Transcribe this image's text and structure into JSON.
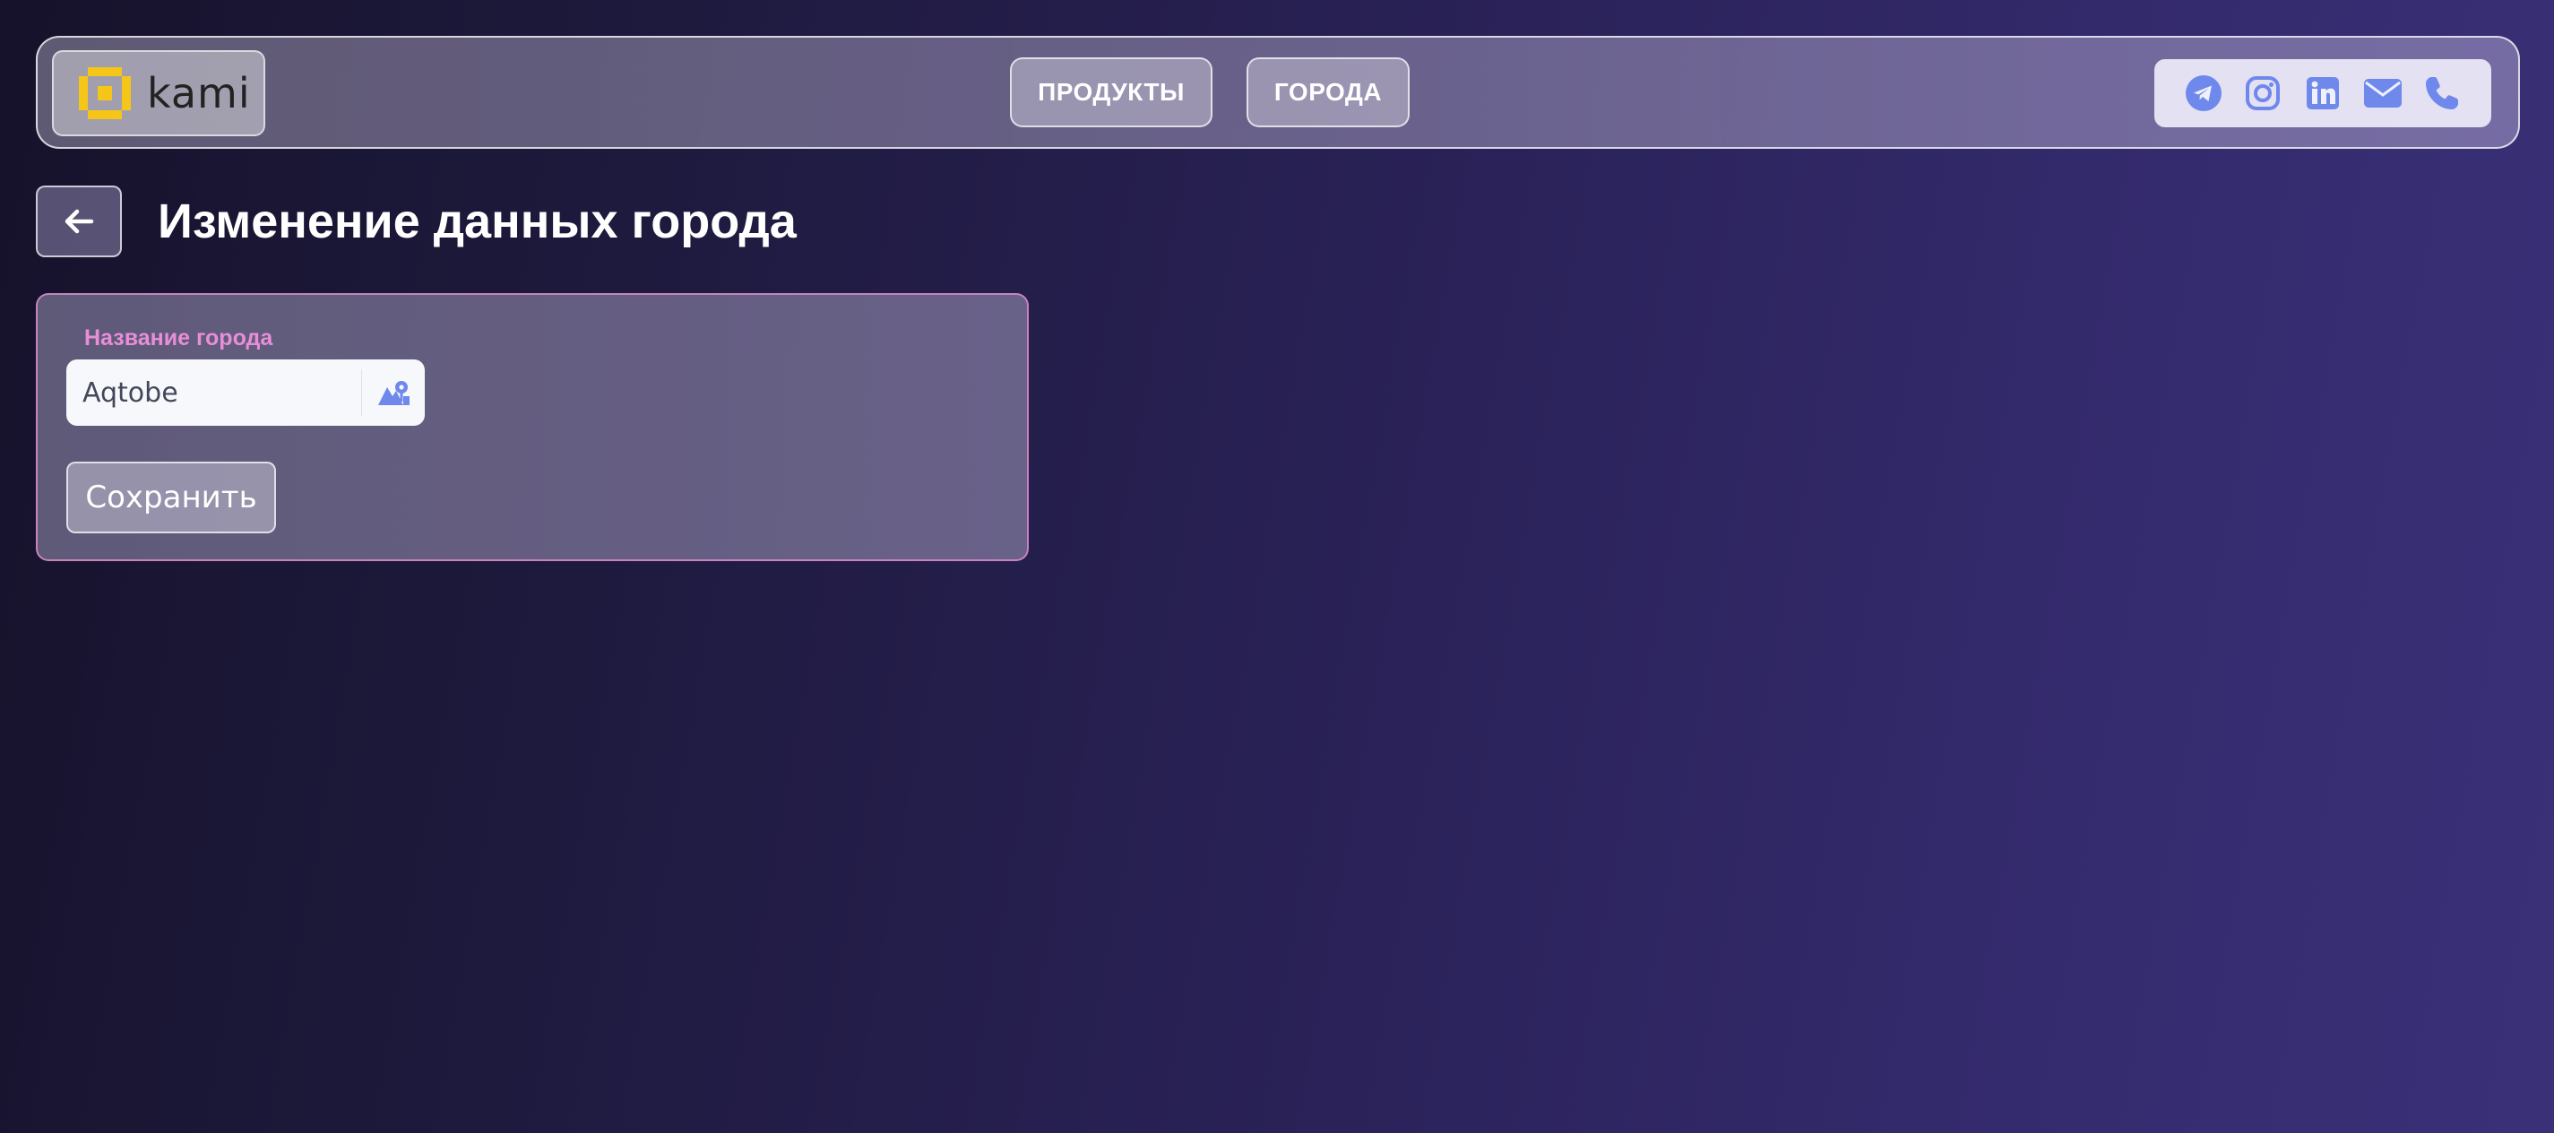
{
  "header": {
    "logo_text": "kami",
    "nav": [
      {
        "label": "ПРОДУКТЫ"
      },
      {
        "label": "ГОРОДА"
      }
    ],
    "social_icons": [
      "telegram-icon",
      "instagram-icon",
      "linkedin-icon",
      "mail-icon",
      "phone-icon"
    ]
  },
  "page": {
    "title": "Изменение данных города"
  },
  "form": {
    "city_label": "Название города",
    "city_value": "Aqtobe",
    "save_label": "Сохранить"
  },
  "colors": {
    "accent_icon": "#6f88ec",
    "logo_yellow": "#f5c518",
    "label_pink": "#e88ed8",
    "card_border": "#d78cc8"
  }
}
